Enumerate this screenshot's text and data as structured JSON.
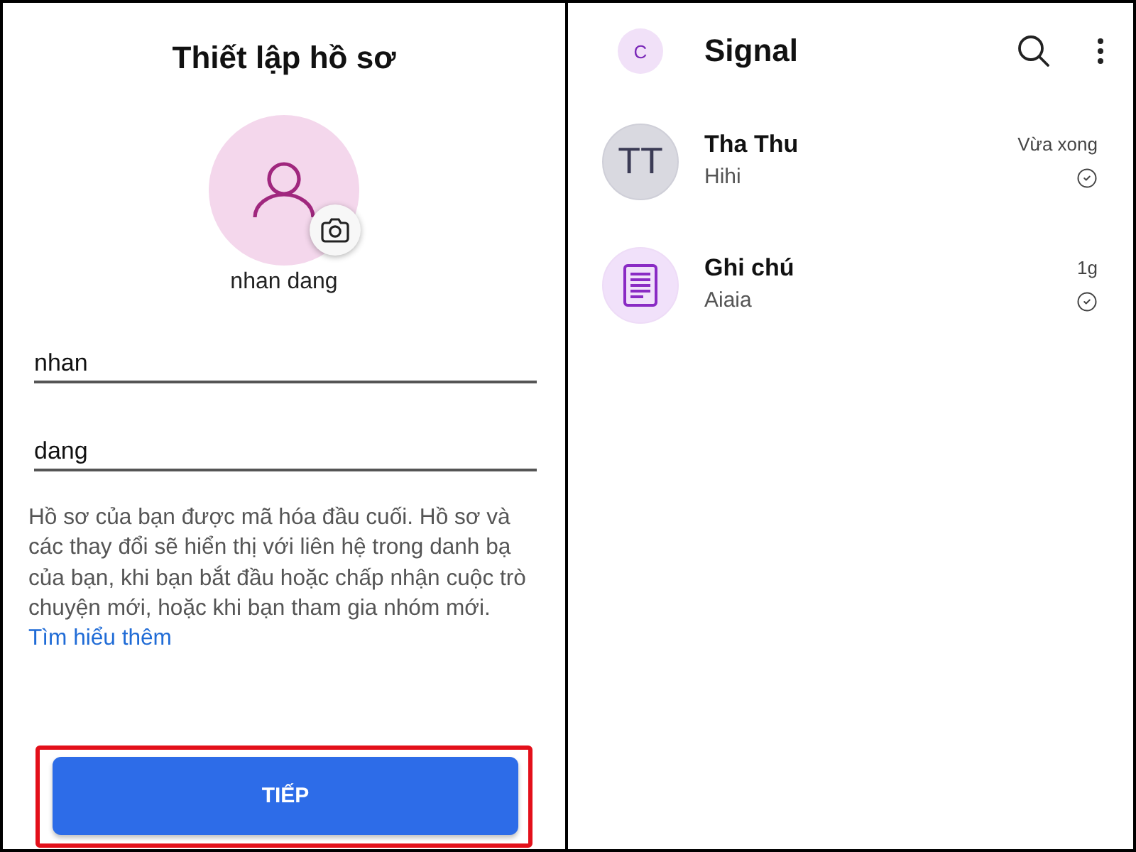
{
  "profile_setup": {
    "title": "Thiết lập hồ sơ",
    "display_name": "nhan dang",
    "fields": [
      {
        "value": "nhan"
      },
      {
        "value": "dang"
      }
    ],
    "notice": "Hồ sơ của bạn được mã hóa đầu cuối. Hồ sơ và các thay đổi sẽ hiển thị với liên hệ trong danh bạ của bạn, khi bạn bắt đầu hoặc chấp nhận cuộc trò chuyện mới, hoặc khi bạn tham gia nhóm mới.",
    "link": "Tìm hiểu thêm",
    "next_button": {
      "label": "TIẾP",
      "highlighted": true
    }
  },
  "chat_list": {
    "account_initial": "C",
    "title": "Signal",
    "conversations": [
      {
        "name": "Tha Thu",
        "preview": "Hihi",
        "time": "Vừa xong",
        "avatar": {
          "kind": "initials",
          "text": "TT"
        }
      },
      {
        "name": "Ghi chú",
        "preview": "Aiaia",
        "time": "1g",
        "avatar": {
          "kind": "note"
        }
      }
    ]
  }
}
